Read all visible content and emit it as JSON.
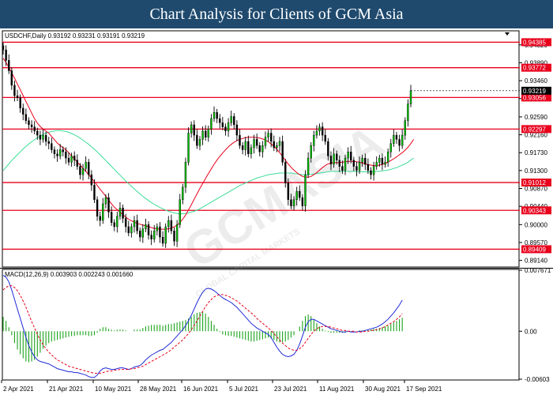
{
  "banner": {
    "title": "Chart Analysis for Clients of GCM Asia"
  },
  "watermark": {
    "text": "GCMASIA",
    "subtext": "GLOBAL CAPITAL MARKETS"
  },
  "chart_data": [
    {
      "type": "candlestick",
      "header": "USDCHF,Daily  0.93192 0.93231 0.93191 0.93219",
      "y_range": [
        0.89,
        0.9445
      ],
      "y_ticks": [
        "0.94320",
        "0.93890",
        "0.93460",
        "0.93030",
        "0.92590",
        "0.92160",
        "0.91730",
        "0.91300",
        "0.90870",
        "0.90440",
        "0.90000",
        "0.89570",
        "0.89140"
      ],
      "current_price": "0.93219",
      "levels": [
        "0.94385",
        "0.93772",
        "0.93056",
        "0.92297",
        "0.91012",
        "0.90343",
        "0.89409"
      ],
      "x_ticks": [
        "2 Apr 2021",
        "21 Apr 2021",
        "10 May 2021",
        "28 May 2021",
        "16 Jun 2021",
        "5 Jul 2021",
        "23 Jul 2021",
        "11 Aug 2021",
        "30 Aug 2021",
        "17 Sep 2021"
      ],
      "close": [
        0.942,
        0.9395,
        0.937,
        0.9335,
        0.931,
        0.9305,
        0.928,
        0.9265,
        0.925,
        0.924,
        0.9235,
        0.9225,
        0.9215,
        0.9205,
        0.9215,
        0.92,
        0.9195,
        0.918,
        0.917,
        0.9165,
        0.918,
        0.9175,
        0.916,
        0.915,
        0.9165,
        0.9155,
        0.914,
        0.912,
        0.9135,
        0.915,
        0.912,
        0.9095,
        0.906,
        0.902,
        0.901,
        0.905,
        0.9065,
        0.903,
        0.9005,
        0.8995,
        0.902,
        0.904,
        0.9015,
        0.8995,
        0.898,
        0.8995,
        0.901,
        0.8985,
        0.897,
        0.899,
        0.9,
        0.8975,
        0.8965,
        0.8985,
        0.8995,
        0.897,
        0.8955,
        0.8995,
        0.901,
        0.8985,
        0.896,
        0.9,
        0.906,
        0.909,
        0.915,
        0.922,
        0.924,
        0.9215,
        0.919,
        0.9205,
        0.9225,
        0.921,
        0.923,
        0.9255,
        0.927,
        0.9255,
        0.9245,
        0.9235,
        0.9225,
        0.9245,
        0.926,
        0.924,
        0.9215,
        0.919,
        0.918,
        0.92,
        0.917,
        0.9185,
        0.9205,
        0.919,
        0.9175,
        0.919,
        0.921,
        0.922,
        0.92,
        0.9185,
        0.919,
        0.92,
        0.915,
        0.91,
        0.906,
        0.9045,
        0.906,
        0.908,
        0.9065,
        0.9045,
        0.912,
        0.916,
        0.919,
        0.9215,
        0.9225,
        0.9235,
        0.9215,
        0.92,
        0.9165,
        0.9145,
        0.917,
        0.9155,
        0.914,
        0.913,
        0.916,
        0.9175,
        0.9155,
        0.914,
        0.913,
        0.915,
        0.916,
        0.9145,
        0.913,
        0.912,
        0.914,
        0.915,
        0.916,
        0.9145,
        0.915,
        0.9175,
        0.9195,
        0.9215,
        0.9205,
        0.919,
        0.9215,
        0.925,
        0.929,
        0.9322
      ],
      "ma_red": [
        0.94,
        0.939,
        0.9378,
        0.9365,
        0.9352,
        0.9338,
        0.9324,
        0.931,
        0.9296,
        0.9282,
        0.9268,
        0.9255,
        0.9244,
        0.9236,
        0.923,
        0.9225,
        0.922,
        0.9212,
        0.9204,
        0.9196,
        0.919,
        0.9185,
        0.918,
        0.9173,
        0.9165,
        0.9158,
        0.915,
        0.9143,
        0.9136,
        0.9128,
        0.912,
        0.9112,
        0.9103,
        0.9094,
        0.9085,
        0.9077,
        0.9068,
        0.9059,
        0.905,
        0.9042,
        0.9036,
        0.903,
        0.9024,
        0.9018,
        0.9013,
        0.9009,
        0.9006,
        0.9003,
        0.9001,
        0.8999,
        0.8997,
        0.8995,
        0.8993,
        0.8991,
        0.899,
        0.8989,
        0.8989,
        0.8989,
        0.899,
        0.8992,
        0.8995,
        0.8999,
        0.9005,
        0.9013,
        0.9023,
        0.9035,
        0.9048,
        0.9061,
        0.9074,
        0.9087,
        0.9099,
        0.9111,
        0.9123,
        0.9134,
        0.9145,
        0.9155,
        0.9164,
        0.9172,
        0.918,
        0.9187,
        0.9193,
        0.9198,
        0.9202,
        0.9205,
        0.9207,
        0.9209,
        0.921,
        0.921,
        0.921,
        0.9209,
        0.9208,
        0.9206,
        0.9203,
        0.9199,
        0.9194,
        0.9188,
        0.9181,
        0.9173,
        0.9164,
        0.9155,
        0.9146,
        0.9138,
        0.9131,
        0.9125,
        0.912,
        0.9116,
        0.9114,
        0.9114,
        0.9116,
        0.912,
        0.9125,
        0.9131,
        0.9137,
        0.9142,
        0.9146,
        0.9148,
        0.9149,
        0.9149,
        0.9149,
        0.915,
        0.9151,
        0.9152,
        0.9152,
        0.9152,
        0.9151,
        0.915,
        0.9148,
        0.9146,
        0.9144,
        0.9143,
        0.9142,
        0.9142,
        0.9143,
        0.9145,
        0.9147,
        0.915,
        0.9154,
        0.9158,
        0.9163,
        0.9168,
        0.9173,
        0.9179,
        0.9186,
        0.9195,
        0.9205
      ],
      "ma_green": [
        0.913,
        0.9138,
        0.9146,
        0.9154,
        0.9161,
        0.9168,
        0.9175,
        0.9182,
        0.9188,
        0.9194,
        0.9199,
        0.9204,
        0.9209,
        0.9213,
        0.9217,
        0.922,
        0.9222,
        0.9224,
        0.9225,
        0.9226,
        0.9226,
        0.9225,
        0.9224,
        0.9222,
        0.9219,
        0.9216,
        0.9212,
        0.9208,
        0.9203,
        0.9198,
        0.9193,
        0.9187,
        0.9181,
        0.9175,
        0.9168,
        0.9161,
        0.9154,
        0.9147,
        0.914,
        0.9133,
        0.9126,
        0.9119,
        0.9112,
        0.9105,
        0.9098,
        0.9092,
        0.9086,
        0.908,
        0.9074,
        0.9068,
        0.9063,
        0.9058,
        0.9053,
        0.9049,
        0.9045,
        0.9041,
        0.9038,
        0.9035,
        0.9032,
        0.903,
        0.9028,
        0.9027,
        0.9026,
        0.9026,
        0.9027,
        0.9028,
        0.903,
        0.9032,
        0.9035,
        0.9038,
        0.9042,
        0.9046,
        0.905,
        0.9054,
        0.9058,
        0.9062,
        0.9066,
        0.907,
        0.9074,
        0.9078,
        0.9082,
        0.9086,
        0.909,
        0.9094,
        0.9097,
        0.91,
        0.9103,
        0.9106,
        0.9109,
        0.9112,
        0.9114,
        0.9116,
        0.9118,
        0.912,
        0.9121,
        0.9122,
        0.9123,
        0.9124,
        0.9124,
        0.9124,
        0.9124,
        0.9124,
        0.9123,
        0.9122,
        0.9121,
        0.912,
        0.912,
        0.912,
        0.9121,
        0.9122,
        0.9123,
        0.9124,
        0.9125,
        0.9126,
        0.9127,
        0.9128,
        0.9128,
        0.9128,
        0.9128,
        0.9128,
        0.9128,
        0.9128,
        0.9128,
        0.9128,
        0.9127,
        0.9127,
        0.9127,
        0.9127,
        0.9127,
        0.9127,
        0.9127,
        0.9128,
        0.9128,
        0.9129,
        0.913,
        0.9131,
        0.9133,
        0.9135,
        0.9137,
        0.914,
        0.9143,
        0.9146,
        0.915,
        0.9155,
        0.916
      ]
    },
    {
      "type": "macd",
      "header": "MACD(12,26,9) 0.003903 0.002243 0.001660",
      "y_range": [
        -0.00603,
        0.00767
      ],
      "y_ticks": [
        "0.007671",
        "0.00",
        "-0.00603"
      ],
      "macd": [
        0.007,
        0.0068,
        0.0062,
        0.0052,
        0.004,
        0.0028,
        0.0016,
        0.0004,
        -0.0008,
        -0.0018,
        -0.0026,
        -0.0032,
        -0.0036,
        -0.0038,
        -0.0039,
        -0.004,
        -0.0041,
        -0.0043,
        -0.0045,
        -0.0047,
        -0.0048,
        -0.0049,
        -0.005,
        -0.0051,
        -0.0051,
        -0.0052,
        -0.0052,
        -0.0053,
        -0.0054,
        -0.0055,
        -0.0057,
        -0.0058,
        -0.0058,
        -0.0055,
        -0.005,
        -0.0047,
        -0.0046,
        -0.0047,
        -0.0048,
        -0.0048,
        -0.0047,
        -0.0046,
        -0.0046,
        -0.0047,
        -0.0048,
        -0.0047,
        -0.0045,
        -0.0044,
        -0.0043,
        -0.004,
        -0.0036,
        -0.0033,
        -0.003,
        -0.0028,
        -0.0026,
        -0.0024,
        -0.0023,
        -0.002,
        -0.0017,
        -0.0014,
        -0.001,
        -0.0006,
        -0.0002,
        0.0002,
        0.0007,
        0.0013,
        0.002,
        0.0028,
        0.0036,
        0.0043,
        0.0049,
        0.0053,
        0.0054,
        0.0053,
        0.0051,
        0.0048,
        0.0045,
        0.0042,
        0.004,
        0.0038,
        0.0036,
        0.0033,
        0.003,
        0.0026,
        0.0022,
        0.0018,
        0.0014,
        0.001,
        0.0007,
        0.0004,
        0.0002,
        0.0,
        -0.0002,
        -0.0004,
        -0.0008,
        -0.0014,
        -0.002,
        -0.0025,
        -0.0029,
        -0.0031,
        -0.0032,
        -0.0031,
        -0.0029,
        -0.0024,
        -0.0016,
        -0.0006,
        0.0005,
        0.0012,
        0.0015,
        0.0015,
        0.0013,
        0.0011,
        0.0009,
        0.0007,
        0.0005,
        0.0003,
        0.0002,
        0.0001,
        0.0,
        -0.0001,
        -0.0001,
        0.0,
        -0.0001,
        -0.0001,
        -0.0001,
        0.0,
        0.0,
        0.0001,
        0.0002,
        0.0003,
        0.0004,
        0.0005,
        0.0007,
        0.0009,
        0.0012,
        0.0015,
        0.0019,
        0.0023,
        0.0028,
        0.0033,
        0.0039
      ],
      "signal": [
        0.0052,
        0.0055,
        0.0057,
        0.0057,
        0.0055,
        0.0051,
        0.0045,
        0.0038,
        0.003,
        0.0021,
        0.0012,
        0.0004,
        -0.0004,
        -0.0011,
        -0.0017,
        -0.0022,
        -0.0026,
        -0.003,
        -0.0033,
        -0.0036,
        -0.0038,
        -0.004,
        -0.0042,
        -0.0044,
        -0.0045,
        -0.0046,
        -0.0047,
        -0.0048,
        -0.0049,
        -0.005,
        -0.0051,
        -0.0052,
        -0.0053,
        -0.0053,
        -0.0053,
        -0.0052,
        -0.0051,
        -0.005,
        -0.005,
        -0.0049,
        -0.0049,
        -0.0048,
        -0.0048,
        -0.0048,
        -0.0048,
        -0.0047,
        -0.0047,
        -0.0046,
        -0.0045,
        -0.0044,
        -0.0042,
        -0.004,
        -0.0038,
        -0.0036,
        -0.0034,
        -0.0032,
        -0.003,
        -0.0028,
        -0.0026,
        -0.0023,
        -0.002,
        -0.0017,
        -0.0014,
        -0.0011,
        -0.0007,
        -0.0003,
        0.0002,
        0.0007,
        0.0013,
        0.0019,
        0.0025,
        0.0031,
        0.0036,
        0.004,
        0.0043,
        0.0045,
        0.0046,
        0.0046,
        0.0045,
        0.0044,
        0.0042,
        0.004,
        0.0038,
        0.0035,
        0.0032,
        0.0029,
        0.0026,
        0.0023,
        0.002,
        0.0016,
        0.0013,
        0.001,
        0.0007,
        0.0004,
        0.0001,
        -0.0003,
        -0.0007,
        -0.0011,
        -0.0015,
        -0.0018,
        -0.0021,
        -0.0023,
        -0.0024,
        -0.0024,
        -0.0022,
        -0.0019,
        -0.0014,
        -0.0009,
        -0.0004,
        0.0,
        0.0003,
        0.0005,
        0.0006,
        0.0006,
        0.0006,
        0.0005,
        0.0004,
        0.0003,
        0.0002,
        0.0001,
        0.0001,
        0.0,
        0.0,
        0.0,
        -0.0001,
        -0.0001,
        -0.0001,
        0.0,
        0.0,
        0.0001,
        0.0001,
        0.0002,
        0.0003,
        0.0004,
        0.0006,
        0.0008,
        0.001,
        0.0012,
        0.0015,
        0.0018,
        0.0022
      ]
    }
  ]
}
